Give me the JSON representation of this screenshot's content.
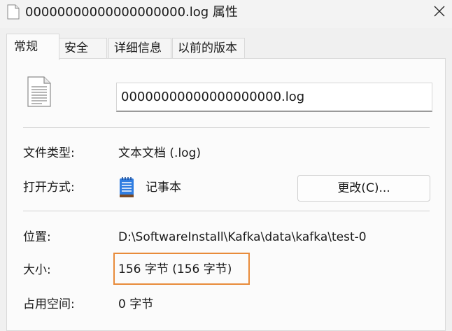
{
  "window": {
    "title": "00000000000000000000.log 属性"
  },
  "tabs": [
    {
      "label": "常规"
    },
    {
      "label": "安全"
    },
    {
      "label": "详细信息"
    },
    {
      "label": "以前的版本"
    }
  ],
  "general": {
    "filename": "00000000000000000000.log",
    "file_type_label": "文件类型:",
    "file_type_value": "文本文档 (.log)",
    "opens_with_label": "打开方式:",
    "opens_with_value": "记事本",
    "change_button": "更改(C)...",
    "location_label": "位置:",
    "location_value": "D:\\SoftwareInstall\\Kafka\\data\\kafka\\test-0",
    "size_label": "大小:",
    "size_value": "156 字节 (156 字节)",
    "size_on_disk_label": "占用空间:",
    "size_on_disk_value": "0 字节"
  },
  "colors": {
    "highlight": "#e88b3a",
    "notepad_icon": "#2f7de1"
  },
  "icons": {
    "title": "document-icon",
    "close": "close-icon",
    "file": "text-file-icon",
    "opens_with": "notepad-icon"
  }
}
